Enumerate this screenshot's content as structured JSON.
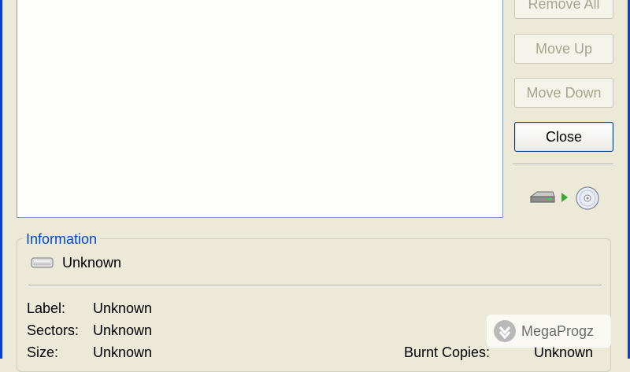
{
  "buttons": {
    "remove_all": "Remove All",
    "move_up": "Move Up",
    "move_down": "Move Down",
    "close": "Close"
  },
  "information": {
    "legend": "Information",
    "drive_name": "Unknown",
    "label_label": "Label:",
    "label_value": "Unknown",
    "sectors_label": "Sectors:",
    "sectors_value": "Unknown",
    "size_label": "Size:",
    "size_value": "Unknown",
    "burnt_copies_label": "Burnt Copies:",
    "burnt_copies_value": "Unknown"
  },
  "icons": {
    "source": "hard-drive-icon",
    "arrow": "play-arrow-icon",
    "target": "cd-disc-icon"
  },
  "watermark": {
    "text": "MegaProgz"
  },
  "colors": {
    "window_bg": "#ece9d8",
    "frame_blue": "#0a3fd6",
    "legend_blue": "#0046d5",
    "button_border_active": "#003c74",
    "disabled_text": "#a6a38e"
  }
}
